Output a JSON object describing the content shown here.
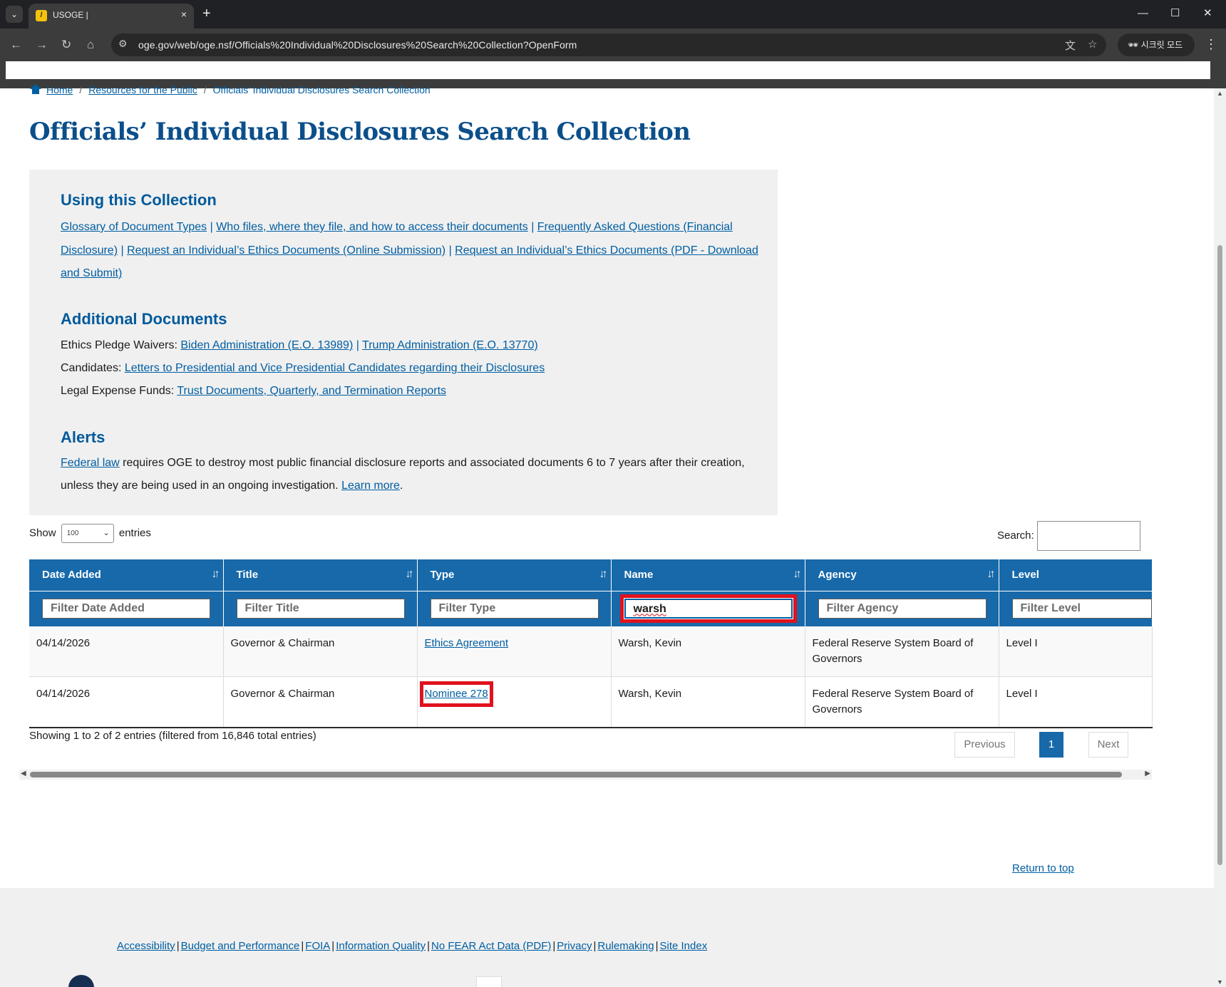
{
  "browser": {
    "tab_title": "USOGE |",
    "tab_close": "×",
    "new_tab": "+",
    "url": "oge.gov/web/oge.nsf/Officials%20Individual%20Disclosures%20Search%20Collection?OpenForm",
    "profile_label": "시크릿 모드",
    "icons": {
      "tab_dropdown": "⌄",
      "back": "←",
      "forward": "→",
      "reload": "↻",
      "home": "⌂",
      "minimize": "—",
      "maximize": "☐",
      "close": "✕",
      "site_settings": "⚙",
      "translate": "文",
      "bookmark": "☆",
      "menu": "⋮",
      "incognito": "🕶"
    }
  },
  "breadcrumb": {
    "home": "Home",
    "separator": "/",
    "resources": "Resources for the Public",
    "current": "Officials’ Individual Disclosures Search Collection"
  },
  "page_title": "Officials’ Individual Disclosures Search Collection",
  "info_box": {
    "using_title": "Using this Collection",
    "using_links": {
      "glossary": "Glossary of Document Types",
      "who_files": "Who files, where they file, and how to access their documents",
      "faq_part1": "Frequently Asked Questions (Financial",
      "faq_part2": "Disclosure)",
      "request_online": "Request an Individual’s Ethics Documents (Online Submission)",
      "request_pdf_part1": "Request an Individual’s Ethics Documents (PDF - Download",
      "request_pdf_part2": "and Submit)",
      "divider": "|"
    },
    "additional_title": "Additional Documents",
    "waivers_label": "Ethics Pledge Waivers:",
    "waivers_biden": "Biden Administration (E.O. 13989)",
    "waivers_trump": "Trump Administration (E.O. 13770)",
    "candidates_label": "Candidates:",
    "candidates_link": "Letters to Presidential and Vice Presidential Candidates regarding their Disclosures",
    "legal_label": "Legal Expense Funds:",
    "legal_link": "Trust Documents, Quarterly, and Termination Reports",
    "alerts_title": "Alerts",
    "alert_link": "Federal law",
    "alert_text1": " requires OGE to destroy most public financial disclosure reports and associated documents 6 to 7 years after their creation,",
    "alert_text2": "unless they are being used in an ongoing investigation. ",
    "alert_learn": "Learn more",
    "alert_period": "."
  },
  "table_controls": {
    "show": "Show",
    "length_value": "100",
    "entries": "entries",
    "search_label": "Search:",
    "search_value": ""
  },
  "table": {
    "columns": [
      "Date Added",
      "Title",
      "Type",
      "Name",
      "Agency",
      "Level"
    ],
    "sort_icon": "↓↑",
    "filters": {
      "date_placeholder": "Filter Date Added",
      "title_placeholder": "Filter Title",
      "type_placeholder": "Filter Type",
      "name_value": "warsh",
      "agency_placeholder": "Filter Agency",
      "level_placeholder": "Filter Level"
    },
    "rows": [
      {
        "date": "04/14/2026",
        "title": "Governor & Chairman",
        "type": "Ethics Agreement",
        "name": "Warsh, Kevin",
        "agency_line1": "Federal Reserve System Board of",
        "agency_line2": "Governors",
        "level": "Level I"
      },
      {
        "date": "04/14/2026",
        "title": "Governor & Chairman",
        "type": "Nominee 278",
        "name": "Warsh, Kevin",
        "agency_line1": "Federal Reserve System Board of",
        "agency_line2": "Governors",
        "level": "Level I"
      }
    ]
  },
  "pagination": {
    "info": "Showing 1 to 2 of 2 entries (filtered from 16,846 total entries)",
    "previous": "Previous",
    "current_page": "1",
    "next": "Next"
  },
  "return_to_top": "Return to top",
  "footer": {
    "links": [
      "Accessibility",
      "Budget and Performance",
      "FOIA",
      "Information Quality",
      "No FEAR Act Data (PDF)",
      "Privacy",
      "Rulemaking",
      "Site Index"
    ],
    "divider": "|"
  },
  "colors": {
    "header_blue": "#1769aa",
    "title_blue": "#0b4f8a",
    "link_blue": "#005ea2",
    "highlight_red": "#e0121d"
  }
}
